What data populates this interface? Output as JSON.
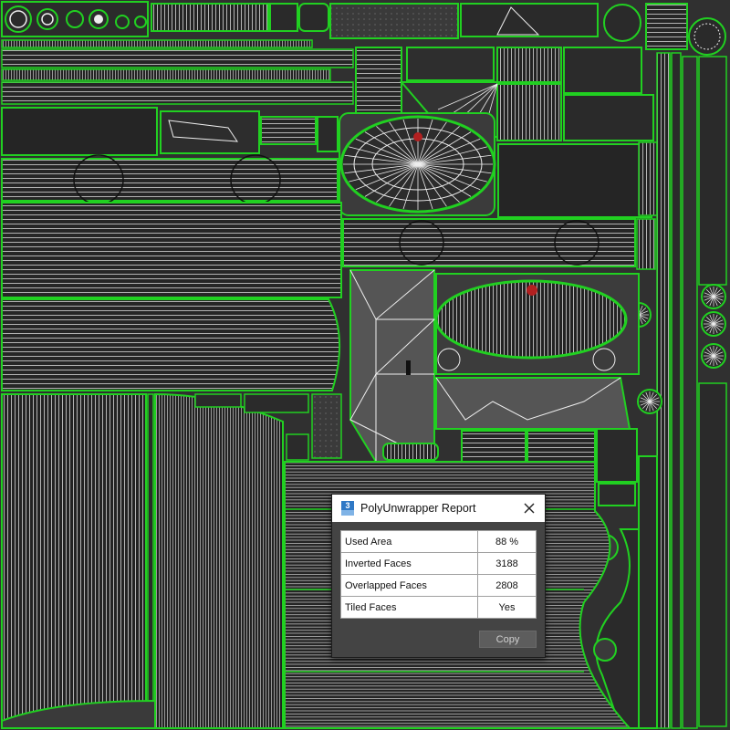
{
  "dialog": {
    "title": "PolyUnwrapper Report",
    "app_icon": "3ds-max-icon",
    "close_icon": "close-icon",
    "rows": [
      {
        "label": "Used Area",
        "value": "88 %"
      },
      {
        "label": "Inverted Faces",
        "value": "3188"
      },
      {
        "label": "Overlapped Faces",
        "value": "2808"
      },
      {
        "label": "Tiled Faces",
        "value": "Yes"
      }
    ],
    "copy_label": "Copy",
    "app_icon_text": "3"
  },
  "colors": {
    "seam_green": "#21d021",
    "wire_white": "#e8e8e8",
    "island_dark": "#2a2a2a",
    "background": "#333333",
    "dialog_bg": "#444444",
    "accent_blue": "#2f78c5"
  }
}
